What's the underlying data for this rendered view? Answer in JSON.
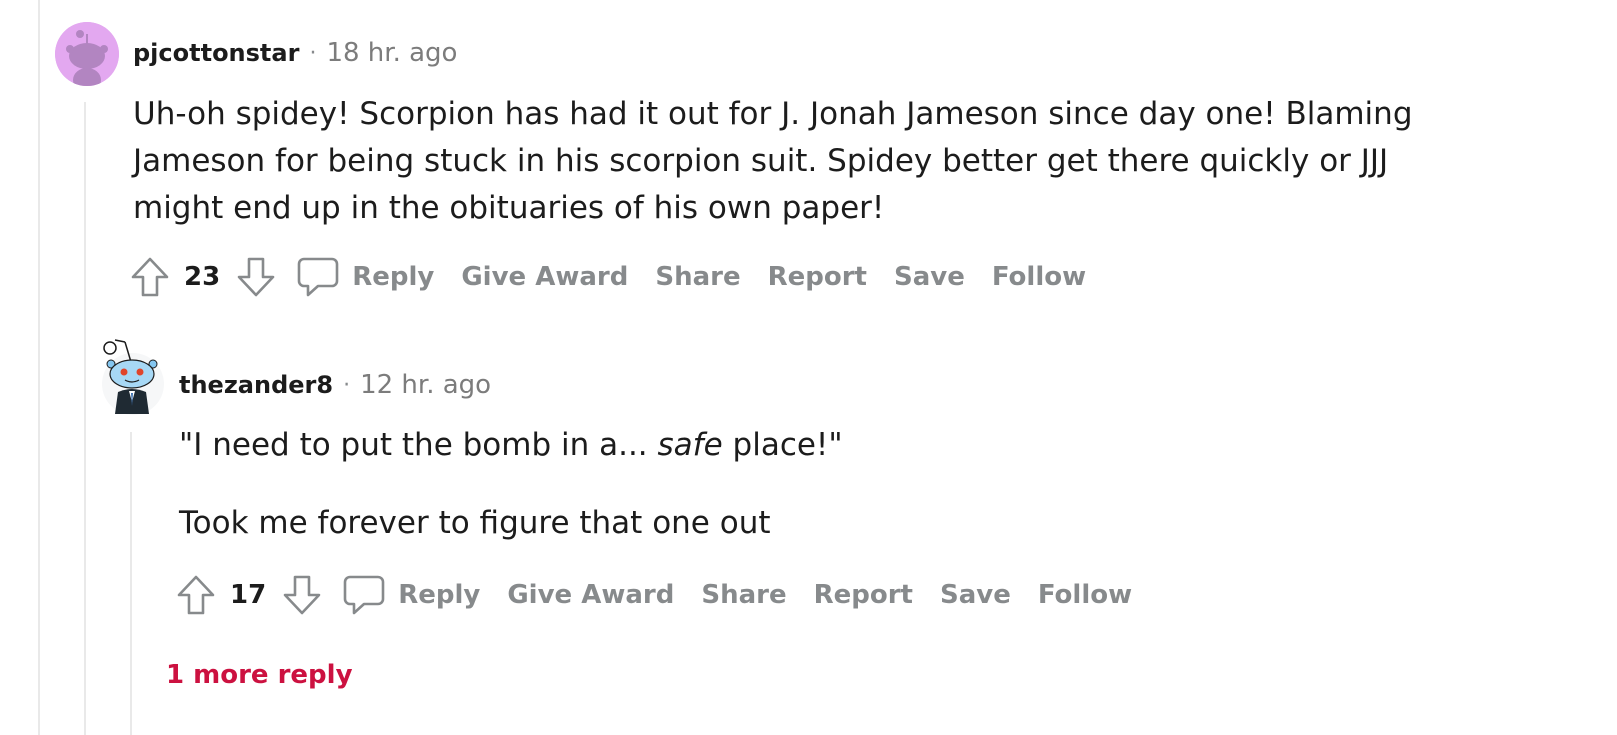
{
  "comments": [
    {
      "username": "pjcottonstar",
      "separator": "·",
      "time": "18 hr. ago",
      "body": "Uh-oh spidey! Scorpion has had it out for J. Jonah Jameson since day one! Blaming Jameson for being stuck in his scorpion suit. Spidey better get there quickly or JJJ might end up in the obituaries of his own paper!",
      "score": "23",
      "actions": {
        "reply": "Reply",
        "give_award": "Give Award",
        "share": "Share",
        "report": "Report",
        "save": "Save",
        "follow": "Follow"
      },
      "avatar_color": "#e3a8f0"
    },
    {
      "username": "thezander8",
      "separator": "·",
      "time": "12 hr. ago",
      "body_quote_before": "\"I need to put the bomb in a... ",
      "body_quote_emph": "safe",
      "body_quote_after": " place!\"",
      "body_line2": "Took me forever to figure that one out",
      "score": "17",
      "actions": {
        "reply": "Reply",
        "give_award": "Give Award",
        "share": "Share",
        "report": "Report",
        "save": "Save",
        "follow": "Follow"
      },
      "avatar_color": "#ffffff"
    }
  ],
  "more_replies": "1 more reply",
  "colors": {
    "accent_red": "#cc1140",
    "muted": "#878a8c",
    "thread_line": "#e9e9e9"
  }
}
